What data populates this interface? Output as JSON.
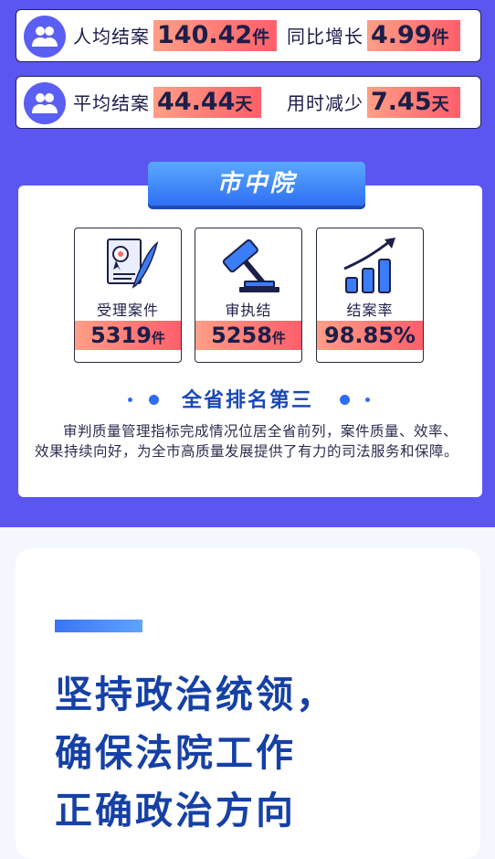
{
  "stats": [
    {
      "label1": "人均结案",
      "value1": "140.42",
      "unit1": "件",
      "label2": "同比增长",
      "value2": "4.99",
      "unit2": "件"
    },
    {
      "label1": "平均结案",
      "value1": "44.44",
      "unit1": "天",
      "label2": "用时减少",
      "value2": "7.45",
      "unit2": "天"
    }
  ],
  "court": {
    "name": "市中院"
  },
  "kpis": [
    {
      "icon": "certificate-quill-icon",
      "label": "受理案件",
      "value": "5319",
      "unit": "件"
    },
    {
      "icon": "gavel-icon",
      "label": "审执结",
      "value": "5258",
      "unit": "件"
    },
    {
      "icon": "bar-growth-icon",
      "label": "结案率",
      "value": "98.85%",
      "unit": ""
    }
  ],
  "rank": {
    "title": "全省排名第三"
  },
  "description": "审判质量管理指标完成情况位居全省前列，案件质量、效率、效果持续向好，为全市高质量发展提供了有力的司法服务和保障。",
  "headline": [
    "坚持政治统领，",
    "确保法院工作",
    "正确政治方向"
  ],
  "colors": {
    "background": "#5b56f0",
    "accent_blue": "#2f6ff5",
    "highlight_start": "#ff9e86",
    "highlight_end": "#ff5f6a",
    "headline": "#1540a6"
  }
}
